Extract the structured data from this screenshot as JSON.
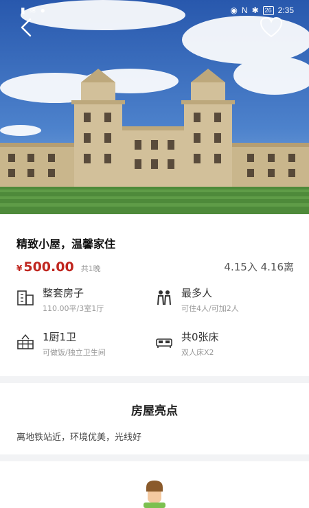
{
  "status_bar": {
    "battery": "26",
    "time": "2:35"
  },
  "icons": {
    "back": "chevron-left-icon",
    "favorite": "heart-outline-icon"
  },
  "listing": {
    "title": "精致小屋，温馨家住",
    "currency_symbol": "¥",
    "price": "500.00",
    "nights": "共1晚",
    "dates": "4.15入 4.16离"
  },
  "features": [
    {
      "icon": "building-icon",
      "title": "整套房子",
      "subtitle": "110.00平/3室1厅"
    },
    {
      "icon": "people-icon",
      "title": "最多人",
      "subtitle": "可住4人/可加2人"
    },
    {
      "icon": "kitchen-icon",
      "title": "1厨1卫",
      "subtitle": "可做饭/独立卫生间"
    },
    {
      "icon": "bed-icon",
      "title": "共0张床",
      "subtitle": "双人床X2"
    }
  ],
  "highlights": {
    "title": "房屋亮点",
    "text": "离地铁站近，环境优美，光线好"
  },
  "colors": {
    "price": "#c0261f",
    "separator": "#f2f3f5",
    "sky": "#2f63b8",
    "lawn": "#4e8a3a"
  }
}
